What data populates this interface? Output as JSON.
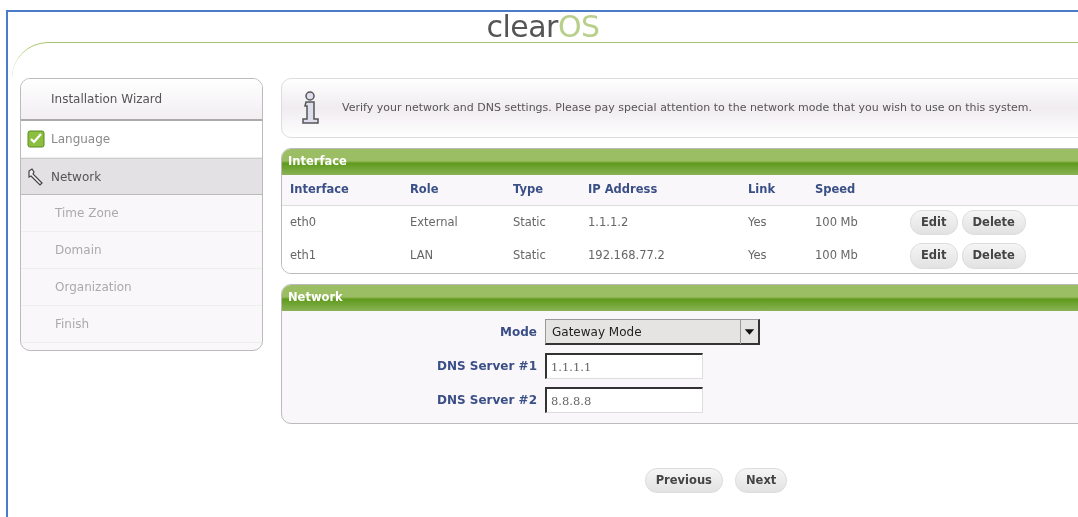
{
  "logo": {
    "part_1": "clear",
    "part_2": "OS"
  },
  "sidebar": {
    "title": "Installation Wizard",
    "items": [
      {
        "label": "Language",
        "completed": true,
        "selected": false,
        "kind": "check"
      },
      {
        "label": "Network",
        "completed": false,
        "selected": true,
        "kind": "wrench"
      },
      {
        "label": "Time Zone",
        "completed": false,
        "selected": false,
        "kind": "plain"
      },
      {
        "label": "Domain",
        "completed": false,
        "selected": false,
        "kind": "plain"
      },
      {
        "label": "Organization",
        "completed": false,
        "selected": false,
        "kind": "plain"
      },
      {
        "label": "Finish",
        "completed": false,
        "selected": false,
        "kind": "plain"
      }
    ]
  },
  "info": "Verify your network and DNS settings. Please pay special attention to the network mode that you wish to use on this system.",
  "interface_panel": {
    "title": "Interface",
    "columns": [
      "Interface",
      "Role",
      "Type",
      "IP Address",
      "Link",
      "Speed"
    ],
    "rows": [
      {
        "cells": [
          "eth0",
          "External",
          "Static",
          "1.1.1.2",
          "Yes",
          "100 Mb"
        ],
        "actions": [
          "Edit",
          "Delete"
        ]
      },
      {
        "cells": [
          "eth1",
          "LAN",
          "Static",
          "192.168.77.2",
          "Yes",
          "100 Mb"
        ],
        "actions": [
          "Edit",
          "Delete"
        ]
      }
    ]
  },
  "network_panel": {
    "title": "Network",
    "fields": [
      {
        "label": "Mode",
        "kind": "select",
        "value": "Gateway Mode"
      },
      {
        "label": "DNS Server #1",
        "kind": "text",
        "value": "1.1.1.1"
      },
      {
        "label": "DNS Server #2",
        "kind": "text",
        "value": "8.8.8.8"
      }
    ]
  },
  "buttons": [
    "Previous",
    "Next"
  ]
}
